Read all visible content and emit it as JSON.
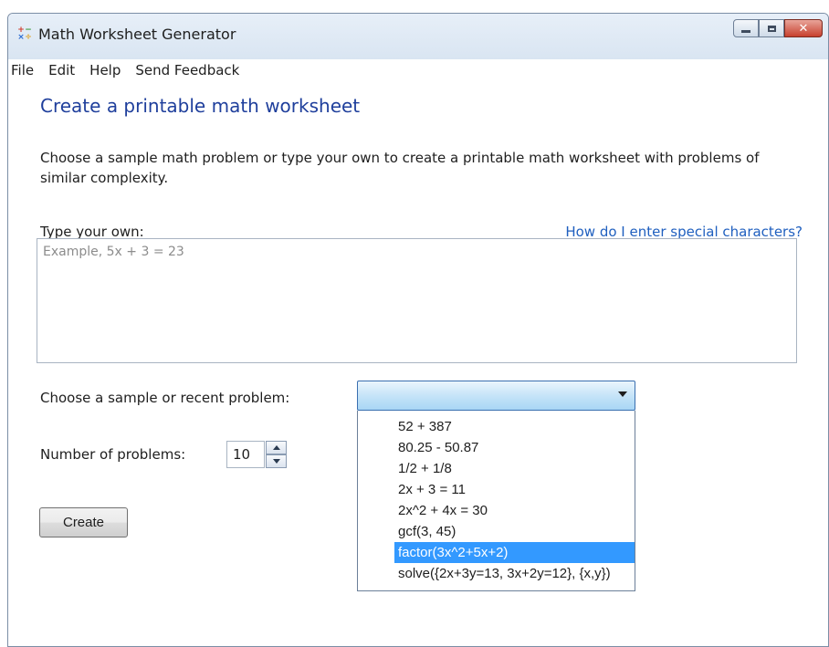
{
  "window": {
    "title": "Math Worksheet Generator",
    "icon": "math-operators-icon"
  },
  "menu": {
    "items": [
      "File",
      "Edit",
      "Help",
      "Send Feedback"
    ]
  },
  "main": {
    "heading": "Create a printable math worksheet",
    "description": "Choose a sample math problem or type your own to create a printable math worksheet with problems of similar complexity.",
    "type_label": "Type your own:",
    "help_link": "How do I enter special characters?",
    "input_placeholder": "Example, 5x + 3 = 23",
    "sample_label": "Choose a sample or recent problem:",
    "sample_selected": "",
    "sample_options": [
      "52 + 387",
      "80.25 - 50.87",
      "1/2 + 1/8",
      "2x + 3 = 11",
      "2x^2 + 4x = 30",
      "gcf(3, 45)",
      "factor(3x^2+5x+2)",
      "solve({2x+3y=13, 3x+2y=12}, {x,y})"
    ],
    "highlighted_option": "factor(3x^2+5x+2)",
    "count_label": "Number of problems:",
    "count_value": "10",
    "create_label": "Create"
  },
  "colors": {
    "heading": "#1f3f9c",
    "link": "#1f5fbf",
    "selection": "#3399ff"
  }
}
